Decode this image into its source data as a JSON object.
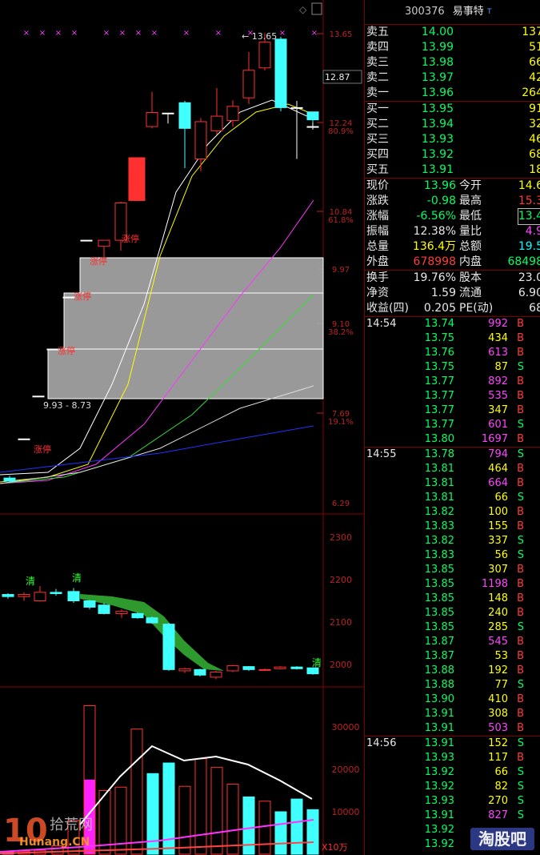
{
  "header": {
    "code": "300376",
    "name": "易事特",
    "mark": "T"
  },
  "order_book": {
    "asks": [
      {
        "label": "卖五",
        "price": "14.00",
        "vol": "137"
      },
      {
        "label": "卖四",
        "price": "13.99",
        "vol": "51"
      },
      {
        "label": "卖三",
        "price": "13.98",
        "vol": "66"
      },
      {
        "label": "卖二",
        "price": "13.97",
        "vol": "42"
      },
      {
        "label": "卖一",
        "price": "13.96",
        "vol": "264"
      }
    ],
    "bids": [
      {
        "label": "买一",
        "price": "13.95",
        "vol": "91"
      },
      {
        "label": "买二",
        "price": "13.94",
        "vol": "32"
      },
      {
        "label": "买三",
        "price": "13.93",
        "vol": "46"
      },
      {
        "label": "买四",
        "price": "13.92",
        "vol": "68"
      },
      {
        "label": "买五",
        "price": "13.91",
        "vol": "18"
      }
    ]
  },
  "quote": [
    {
      "l1": "现价",
      "v1": "13.96",
      "c1": "g",
      "l2": "今开",
      "v2": "14.6",
      "c2": "y"
    },
    {
      "l1": "涨跌",
      "v1": "-0.98",
      "c1": "g",
      "l2": "最高",
      "v2": "15.3",
      "c2": "r"
    },
    {
      "l1": "涨幅",
      "v1": "-6.56%",
      "c1": "g",
      "l2": "最低",
      "v2": "13.4",
      "c2": "g"
    },
    {
      "l1": "振幅",
      "v1": "12.38%",
      "c1": "w",
      "l2": "量比",
      "v2": "4.9",
      "c2": "m"
    },
    {
      "l1": "总量",
      "v1": "136.4万",
      "c1": "y",
      "l2": "总额",
      "v2": "19.5",
      "c2": "c"
    },
    {
      "l1": "外盘",
      "v1": "678998",
      "c1": "r",
      "l2": "内盘",
      "v2": "68498",
      "c2": "g"
    }
  ],
  "fundamentals": [
    {
      "l1": "换手",
      "v1": "19.76%",
      "l2": "股本",
      "v2": "23.0"
    },
    {
      "l1": "净资",
      "v1": "1.59",
      "l2": "流通",
      "v2": "6.90"
    },
    {
      "l1": "收益(四)",
      "v1": "0.205",
      "l2": "PE(动)",
      "v2": "68"
    }
  ],
  "ticks": [
    {
      "time": "14:54",
      "price": "13.74",
      "vol": "992",
      "side": "B"
    },
    {
      "time": "",
      "price": "13.75",
      "vol": "434",
      "side": "B"
    },
    {
      "time": "",
      "price": "13.76",
      "vol": "613",
      "side": "B"
    },
    {
      "time": "",
      "price": "13.75",
      "vol": "87",
      "side": "S"
    },
    {
      "time": "",
      "price": "13.77",
      "vol": "892",
      "side": "B"
    },
    {
      "time": "",
      "price": "13.77",
      "vol": "535",
      "side": "B"
    },
    {
      "time": "",
      "price": "13.77",
      "vol": "347",
      "side": "B"
    },
    {
      "time": "",
      "price": "13.77",
      "vol": "601",
      "side": "S"
    },
    {
      "time": "",
      "price": "13.80",
      "vol": "1697",
      "side": "B"
    },
    {
      "time": "14:55",
      "price": "13.78",
      "vol": "794",
      "side": "S"
    },
    {
      "time": "",
      "price": "13.81",
      "vol": "464",
      "side": "B"
    },
    {
      "time": "",
      "price": "13.81",
      "vol": "664",
      "side": "B"
    },
    {
      "time": "",
      "price": "13.81",
      "vol": "66",
      "side": "S"
    },
    {
      "time": "",
      "price": "13.82",
      "vol": "100",
      "side": "B"
    },
    {
      "time": "",
      "price": "13.83",
      "vol": "155",
      "side": "B"
    },
    {
      "time": "",
      "price": "13.82",
      "vol": "337",
      "side": "S"
    },
    {
      "time": "",
      "price": "13.83",
      "vol": "56",
      "side": "S"
    },
    {
      "time": "",
      "price": "13.85",
      "vol": "307",
      "side": "B"
    },
    {
      "time": "",
      "price": "13.85",
      "vol": "1198",
      "side": "B"
    },
    {
      "time": "",
      "price": "13.85",
      "vol": "148",
      "side": "B"
    },
    {
      "time": "",
      "price": "13.85",
      "vol": "240",
      "side": "B"
    },
    {
      "time": "",
      "price": "13.85",
      "vol": "285",
      "side": "S"
    },
    {
      "time": "",
      "price": "13.87",
      "vol": "545",
      "side": "B"
    },
    {
      "time": "",
      "price": "13.87",
      "vol": "53",
      "side": "B"
    },
    {
      "time": "",
      "price": "13.88",
      "vol": "192",
      "side": "B"
    },
    {
      "time": "",
      "price": "13.88",
      "vol": "77",
      "side": "S"
    },
    {
      "time": "",
      "price": "13.90",
      "vol": "410",
      "side": "B"
    },
    {
      "time": "",
      "price": "13.91",
      "vol": "308",
      "side": "B"
    },
    {
      "time": "",
      "price": "13.91",
      "vol": "503",
      "side": "B"
    },
    {
      "time": "14:56",
      "price": "13.91",
      "vol": "152",
      "side": "S"
    },
    {
      "time": "",
      "price": "13.93",
      "vol": "117",
      "side": "B"
    },
    {
      "time": "",
      "price": "13.92",
      "vol": "66",
      "side": "S"
    },
    {
      "time": "",
      "price": "13.92",
      "vol": "82",
      "side": "S"
    },
    {
      "time": "",
      "price": "13.93",
      "vol": "270",
      "side": "S"
    },
    {
      "time": "",
      "price": "13.91",
      "vol": "827",
      "side": "S"
    },
    {
      "time": "",
      "price": "13.92",
      "vol": "",
      "side": ""
    },
    {
      "time": "",
      "price": "13.92",
      "vol": "",
      "side": ""
    }
  ],
  "chart_data": {
    "type": "candlestick",
    "price_axis": {
      "labels": [
        "13.65",
        "12.87",
        "12.24",
        "80.9%",
        "10.84",
        "61.8%",
        "9.97",
        "9.10",
        "38.2%",
        "7.69",
        "19.1%",
        "6.29"
      ]
    },
    "annotations": {
      "high_label": "13.65",
      "box_label": "9.93 - 8.73",
      "limit_up": "涨停",
      "clear": "清",
      "unit": "X10万"
    },
    "price_ylim": [
      6.29,
      13.65
    ],
    "candles": [
      {
        "o": 6.38,
        "c": 6.33,
        "h": 6.42,
        "l": 6.31
      },
      {
        "o": 7.02,
        "c": 7.02,
        "h": 7.02,
        "l": 7.02
      },
      {
        "o": 7.72,
        "c": 7.72,
        "h": 7.72,
        "l": 7.72
      },
      {
        "o": 8.49,
        "c": 8.49,
        "h": 8.49,
        "l": 8.49
      },
      {
        "o": 9.34,
        "c": 9.34,
        "h": 9.34,
        "l": 9.34
      },
      {
        "o": 10.27,
        "c": 10.27,
        "h": 10.27,
        "l": 10.27
      },
      {
        "o": 10.17,
        "c": 10.27,
        "h": 10.27,
        "l": 9.98
      },
      {
        "o": 10.27,
        "c": 10.88,
        "h": 10.9,
        "l": 10.1
      },
      {
        "o": 10.92,
        "c": 11.62,
        "h": 11.62,
        "l": 10.92
      },
      {
        "o": 12.13,
        "c": 12.36,
        "h": 12.7,
        "l": 12.1
      },
      {
        "o": 12.35,
        "c": 12.35,
        "h": 12.35,
        "l": 12.18
      },
      {
        "o": 12.52,
        "c": 12.1,
        "h": 12.55,
        "l": 11.45
      },
      {
        "o": 11.6,
        "c": 12.21,
        "h": 12.27,
        "l": 11.4
      },
      {
        "o": 12.06,
        "c": 12.3,
        "h": 12.76,
        "l": 12.0
      },
      {
        "o": 12.23,
        "c": 12.46,
        "h": 12.56,
        "l": 12.13
      },
      {
        "o": 12.6,
        "c": 13.05,
        "h": 13.35,
        "l": 12.5
      },
      {
        "o": 13.09,
        "c": 13.51,
        "h": 13.65,
        "l": 13.05
      },
      {
        "o": 13.56,
        "c": 12.44,
        "h": 13.6,
        "l": 12.38
      },
      {
        "o": 12.44,
        "c": 12.44,
        "h": 12.55,
        "l": 11.6
      },
      {
        "o": 12.37,
        "c": 12.24,
        "h": 12.37,
        "l": 12.2
      },
      {
        "o": 12.13,
        "c": 12.13,
        "h": 12.2,
        "l": 12.08
      }
    ],
    "mid_axis": {
      "labels": [
        "2300",
        "2200",
        "2100",
        "2000"
      ]
    },
    "mid_ylim": [
      1970,
      2330
    ],
    "mid_candles": [
      {
        "o": 2165,
        "c": 2160,
        "h": 2168,
        "l": 2155
      },
      {
        "o": 2160,
        "c": 2165,
        "h": 2170,
        "l": 2150
      },
      {
        "o": 2150,
        "c": 2170,
        "h": 2185,
        "l": 2148
      },
      {
        "o": 2170,
        "c": 2167,
        "h": 2178,
        "l": 2162
      },
      {
        "o": 2172,
        "c": 2150,
        "h": 2180,
        "l": 2145
      },
      {
        "o": 2150,
        "c": 2135,
        "h": 2152,
        "l": 2130
      },
      {
        "o": 2140,
        "c": 2120,
        "h": 2145,
        "l": 2118
      },
      {
        "o": 2120,
        "c": 2125,
        "h": 2130,
        "l": 2110
      },
      {
        "o": 2120,
        "c": 2110,
        "h": 2123,
        "l": 2108
      },
      {
        "o": 2110,
        "c": 2098,
        "h": 2113,
        "l": 2096
      },
      {
        "o": 2095,
        "c": 1988,
        "h": 2098,
        "l": 1985
      },
      {
        "o": 1985,
        "c": 1990,
        "h": 1992,
        "l": 1980
      },
      {
        "o": 1988,
        "c": 1975,
        "h": 1990,
        "l": 1972
      },
      {
        "o": 1970,
        "c": 1982,
        "h": 1985,
        "l": 1965
      },
      {
        "o": 1985,
        "c": 1997,
        "h": 1999,
        "l": 1982
      },
      {
        "o": 1995,
        "c": 1988,
        "h": 1996,
        "l": 1985
      },
      {
        "o": 1988,
        "c": 1988,
        "h": 1990,
        "l": 1985
      },
      {
        "o": 1990,
        "c": 1994,
        "h": 1996,
        "l": 1988
      },
      {
        "o": 1994,
        "c": 1990,
        "h": 1996,
        "l": 1988
      },
      {
        "o": 1992,
        "c": 1978,
        "h": 1993,
        "l": 1976
      }
    ],
    "vol_axis": {
      "labels": [
        "30000",
        "20000",
        "10000"
      ]
    },
    "vol_ylim": [
      0,
      36000
    ],
    "volume": [
      {
        "v": 500,
        "col": "pink"
      },
      {
        "v": 700,
        "col": "red"
      },
      {
        "v": 900,
        "col": "red"
      },
      {
        "v": 2000,
        "col": "red"
      },
      {
        "v": 8000,
        "col": "red"
      },
      {
        "v": 17500,
        "col": "magenta"
      },
      {
        "v": 35000,
        "col": "red"
      },
      {
        "v": 15000,
        "col": "red"
      },
      {
        "v": 15800,
        "col": "red"
      },
      {
        "v": 29500,
        "col": "red"
      },
      {
        "v": 19000,
        "col": "cyan"
      },
      {
        "v": 21500,
        "col": "cyan"
      },
      {
        "v": 16000,
        "col": "red"
      },
      {
        "v": 22500,
        "col": "red"
      },
      {
        "v": 20500,
        "col": "red"
      },
      {
        "v": 16500,
        "col": "red"
      },
      {
        "v": 13500,
        "col": "cyan"
      },
      {
        "v": 12500,
        "col": "red"
      },
      {
        "v": 10000,
        "col": "cyan"
      },
      {
        "v": 13000,
        "col": "cyan"
      },
      {
        "v": 6500,
        "col": "red"
      },
      {
        "v": 10500,
        "col": "cyan"
      }
    ]
  },
  "watermark": {
    "w1": "10",
    "w2": "拾荒网",
    "w3": "Hunang.CN",
    "w4": "淘股吧"
  }
}
